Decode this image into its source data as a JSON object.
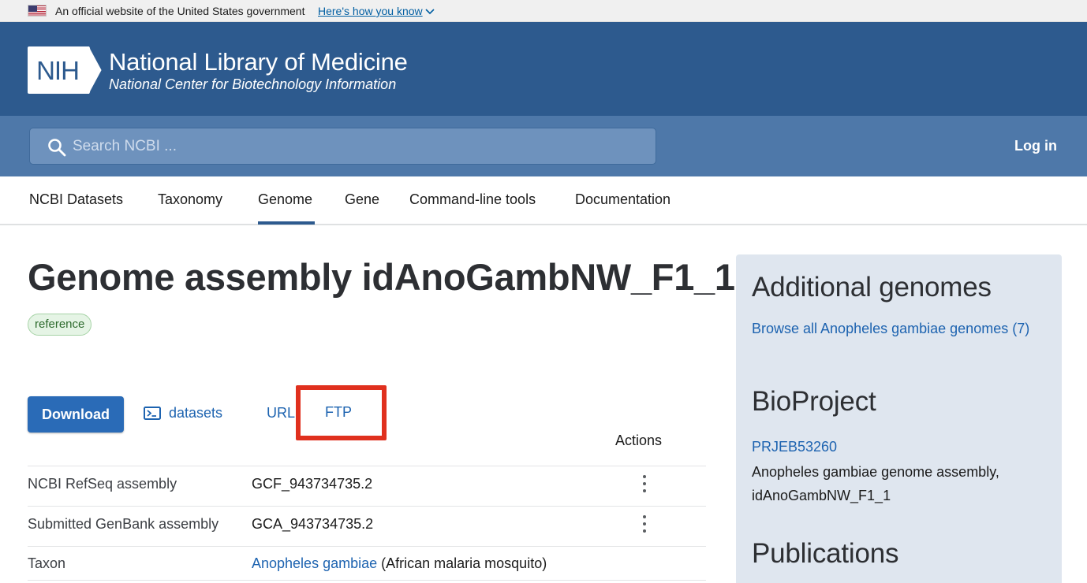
{
  "gov_banner": {
    "text": "An official website of the United States government",
    "link": "Here's how you know"
  },
  "header": {
    "logo_text": "NIH",
    "title": "National Library of Medicine",
    "subtitle": "National Center for Biotechnology Information"
  },
  "search": {
    "placeholder": "Search NCBI ...",
    "login_label": "Log in"
  },
  "nav": {
    "items": [
      "NCBI Datasets",
      "Taxonomy",
      "Genome",
      "Gene",
      "Command-line tools",
      "Documentation"
    ],
    "active": "Genome"
  },
  "main": {
    "title": "Genome assembly idAnoGambNW_F1_1",
    "badge": "reference",
    "buttons": {
      "download": "Download",
      "datasets": "datasets",
      "url": "URL",
      "ftp": "FTP"
    },
    "actions_header": "Actions",
    "rows": [
      {
        "label": "NCBI RefSeq assembly",
        "value": "GCF_943734735.2"
      },
      {
        "label": "Submitted GenBank assembly",
        "value": "GCA_943734735.2"
      },
      {
        "label": "Taxon",
        "value_link": "Anopheles gambiae",
        "value_extra": " (African malaria mosquito)"
      }
    ]
  },
  "sidebar": {
    "additional_title": "Additional genomes",
    "browse_link": "Browse all Anopheles gambiae genomes (7)",
    "bioproject_title": "BioProject",
    "bioproject_id": "PRJEB53260",
    "bioproject_desc": "Anopheles gambiae genome assembly, idAnoGambNW_F1_1",
    "publications_title": "Publications"
  },
  "colors": {
    "header_bg": "#2d5a8e",
    "search_band_bg": "#4e78a9",
    "link": "#1d63b0",
    "download_btn": "#2a6bb7",
    "highlight": "#e0301e",
    "badge_bg": "#e5f4e5"
  }
}
